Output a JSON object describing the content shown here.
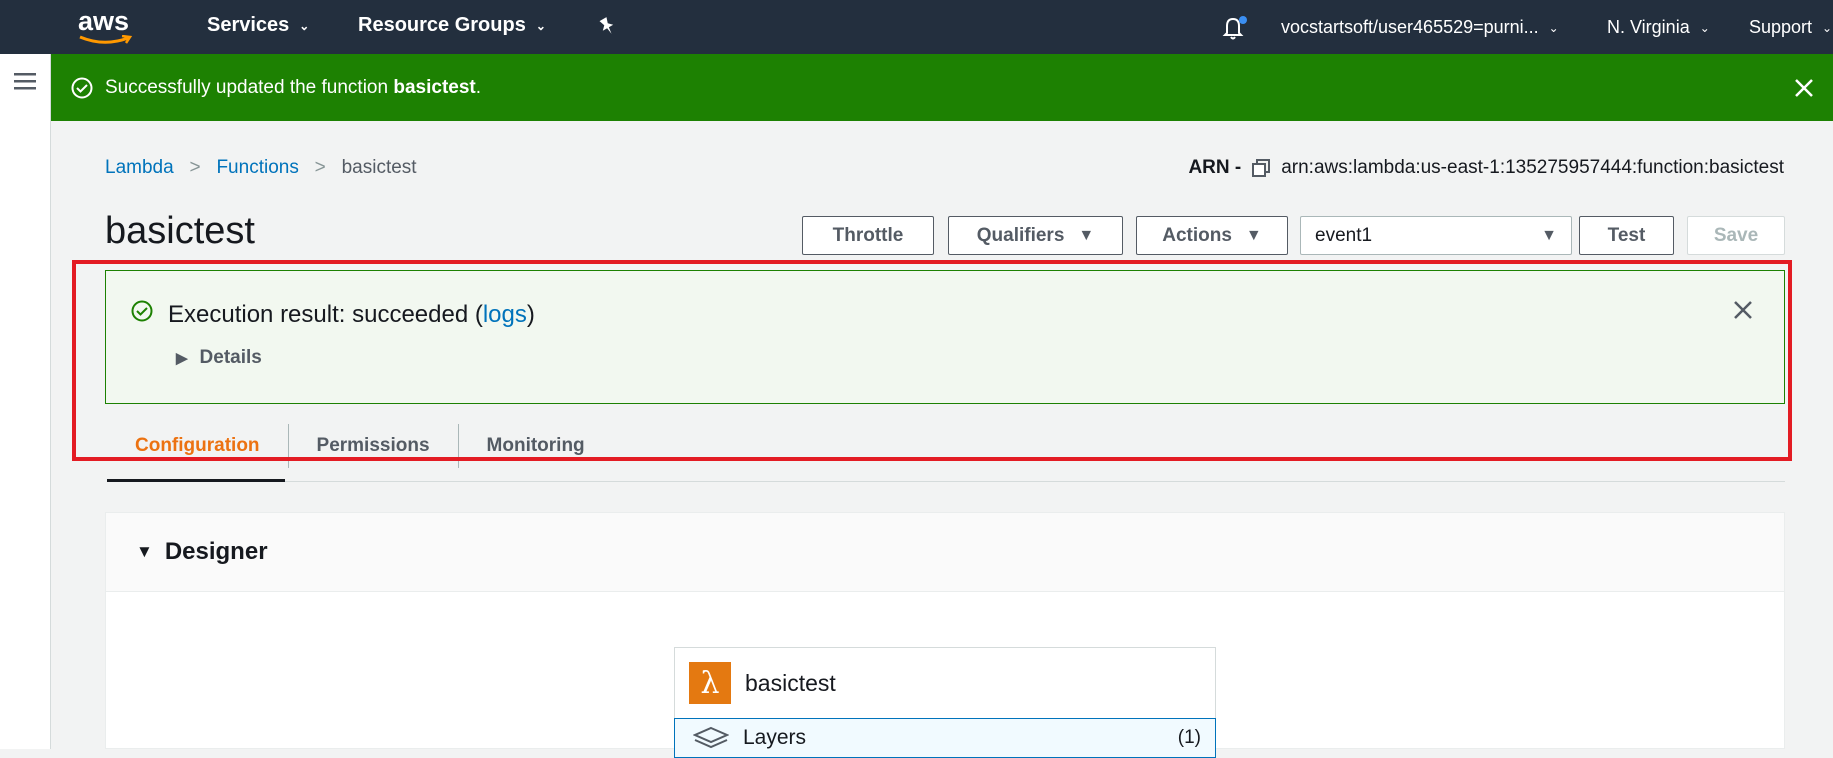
{
  "topnav": {
    "logo_text": "aws",
    "services": "Services",
    "resource_groups": "Resource Groups",
    "account": "vocstartsoft/user465529=purni...",
    "region": "N. Virginia",
    "support": "Support"
  },
  "flash": {
    "prefix": "Successfully updated the function ",
    "function_name": "basictest",
    "suffix": "."
  },
  "breadcrumb": {
    "items": [
      "Lambda",
      "Functions",
      "basictest"
    ]
  },
  "arn": {
    "label": "ARN -",
    "value": "arn:aws:lambda:us-east-1:135275957444:function:basictest"
  },
  "page_title": "basictest",
  "toolbar": {
    "throttle": "Throttle",
    "qualifiers": "Qualifiers",
    "actions": "Actions",
    "test_event": "event1",
    "test": "Test",
    "save": "Save"
  },
  "execution_result": {
    "prefix": "Execution result: succeeded (",
    "logs_link": "logs",
    "suffix": ")",
    "details": "Details"
  },
  "tabs": [
    {
      "label": "Configuration",
      "active": true
    },
    {
      "label": "Permissions",
      "active": false
    },
    {
      "label": "Monitoring",
      "active": false
    }
  ],
  "designer": {
    "title": "Designer",
    "function_name": "basictest",
    "layers_label": "Layers",
    "layers_count": "(1)"
  },
  "colors": {
    "nav_bg": "#232f3e",
    "success": "#1d8102",
    "link": "#0073bb",
    "active_tab": "#ec7211",
    "highlight": "#e31b23"
  }
}
